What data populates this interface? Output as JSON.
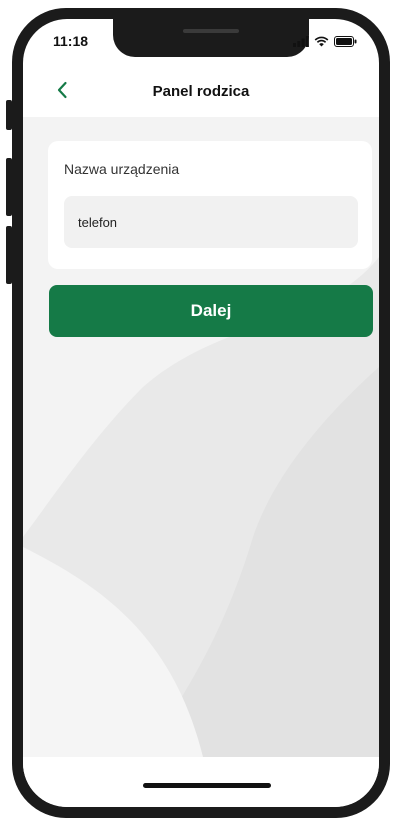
{
  "status_bar": {
    "time": "11:18",
    "icons": [
      "signal-icon",
      "wifi-icon",
      "battery-icon"
    ]
  },
  "header": {
    "back_icon": "chevron-left-icon",
    "title": "Panel rodzica"
  },
  "form": {
    "label": "Nazwa urządzenia",
    "value": "telefon"
  },
  "actions": {
    "next_label": "Dalej"
  },
  "colors": {
    "accent": "#157a47",
    "back_icon": "#157a47"
  }
}
